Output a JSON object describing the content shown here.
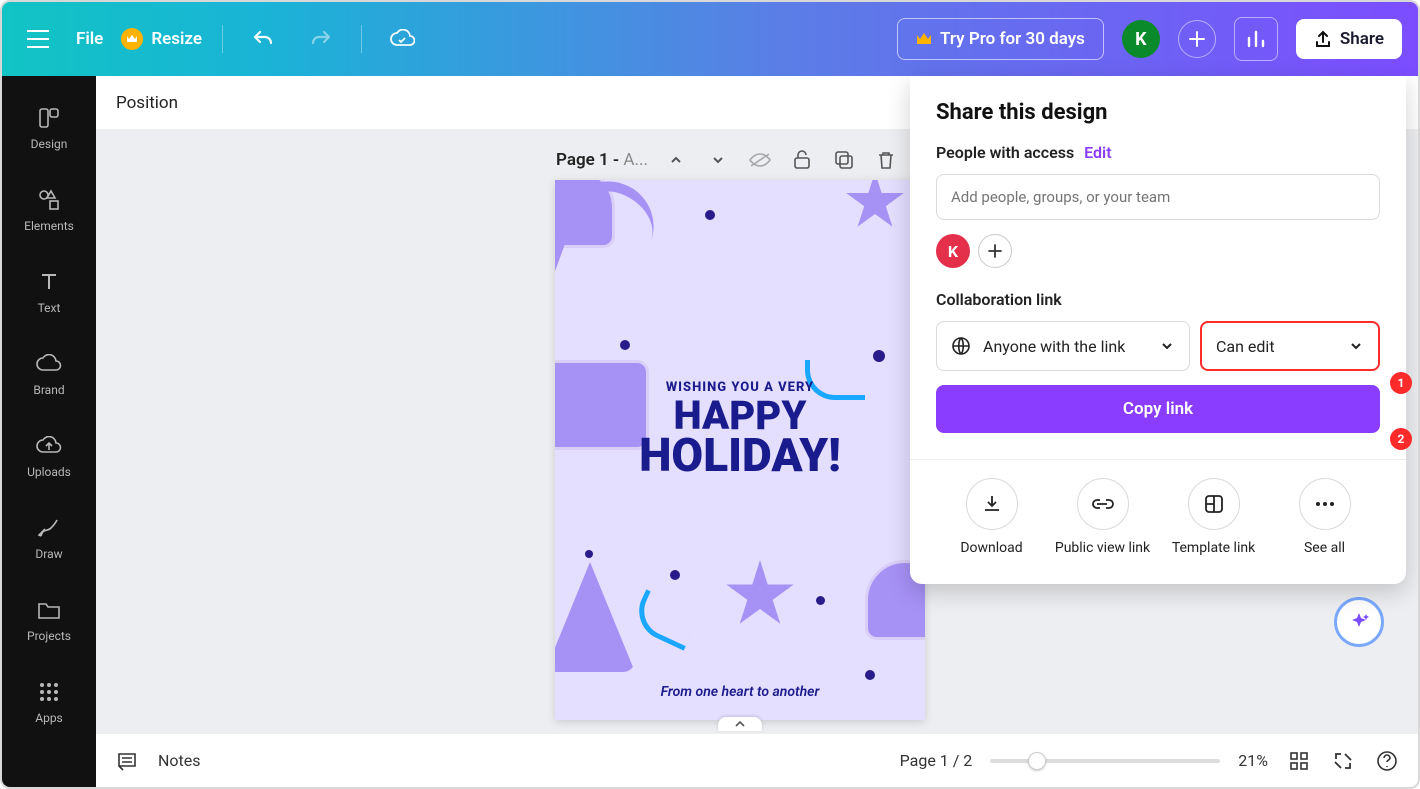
{
  "topbar": {
    "file_label": "File",
    "resize_label": "Resize",
    "try_pro_label": "Try Pro for 30 days",
    "avatar_initial": "K",
    "share_label": "Share"
  },
  "sidebar": {
    "items": [
      {
        "label": "Design"
      },
      {
        "label": "Elements"
      },
      {
        "label": "Text"
      },
      {
        "label": "Brand"
      },
      {
        "label": "Uploads"
      },
      {
        "label": "Draw"
      },
      {
        "label": "Projects"
      },
      {
        "label": "Apps"
      }
    ]
  },
  "toolbar2": {
    "position_label": "Position"
  },
  "page_controls": {
    "page_prefix": "Page 1 - ",
    "page_suffix": "A..."
  },
  "card": {
    "wish": "WISHING YOU A VERY",
    "line1": "HAPPY",
    "line2": "HOLIDAY!",
    "footer": "From one heart to another"
  },
  "share_panel": {
    "title": "Share this design",
    "access_label": "People with access",
    "edit_label": "Edit",
    "add_placeholder": "Add people, groups, or your team",
    "person_initial": "K",
    "collab_label": "Collaboration link",
    "scope_label": "Anyone with the link",
    "permission_label": "Can edit",
    "copy_label": "Copy link",
    "callout1": "1",
    "callout2": "2",
    "actions": [
      {
        "label": "Download"
      },
      {
        "label": "Public view link"
      },
      {
        "label": "Template link"
      },
      {
        "label": "See all"
      }
    ]
  },
  "bottombar": {
    "notes_label": "Notes",
    "page_indicator": "Page 1 / 2",
    "zoom_label": "21%"
  }
}
